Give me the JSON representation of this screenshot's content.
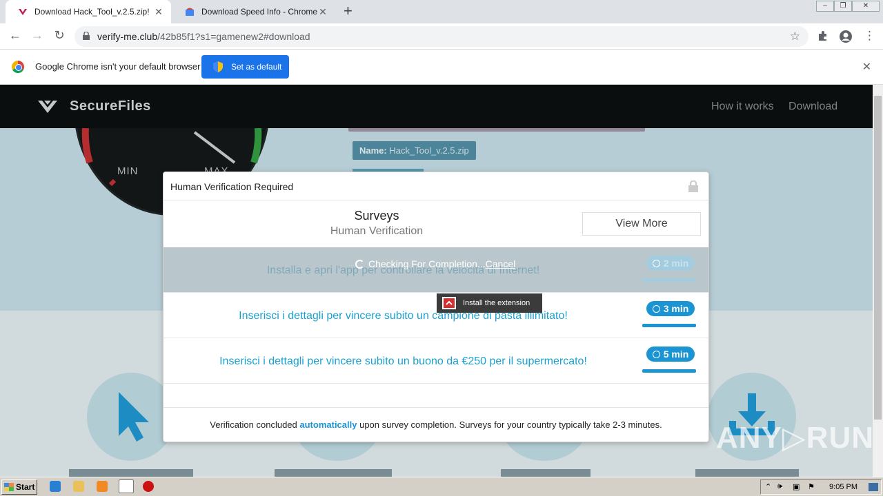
{
  "browser": {
    "tabs": [
      {
        "title": "Download Hack_Tool_v.2.5.zip!",
        "active": true
      },
      {
        "title": "Download Speed Info - Chrome Web",
        "active": false
      }
    ],
    "new_tab": "+",
    "close": "✕",
    "url_host": "verify-me.club",
    "url_path": "/42b85f1?s1=gamenew2#download",
    "infobar_text": "Google Chrome isn't your default browser",
    "set_default_label": "Set as default"
  },
  "site": {
    "brand": "SecureFiles",
    "nav": [
      "How it works",
      "Download"
    ],
    "gauge_min": "MIN",
    "gauge_max": "MAX",
    "name_label": "Name:",
    "file_name": "Hack_Tool_v.2.5.zip"
  },
  "modal": {
    "title": "Human Verification Required",
    "surveys_title": "Surveys",
    "surveys_subtitle": "Human Verification",
    "view_more": "View More",
    "checking_text": "Checking For Completion...",
    "cancel_text": "Cancel",
    "tooltip": "Install the extension",
    "offers": [
      {
        "text": "Installa e apri l'app per controllare la velocità di Internet!",
        "time": "2 min",
        "state": "checking"
      },
      {
        "text": "Inserisci i dettagli per vincere subito un campione di pasta illimitato!",
        "time": "3 min",
        "state": "normal"
      },
      {
        "text": "Inserisci i dettagli per vincere subito un buono da €250 per il supermercato!",
        "time": "5 min",
        "state": "normal"
      }
    ],
    "footer_before": "Verification concluded ",
    "footer_highlight": "automatically",
    "footer_after": " upon survey completion. Surveys for your country typically take 2-3 minutes."
  },
  "watermark": "ANY▷RUN",
  "taskbar": {
    "start_label": "Start",
    "clock": "9:05 PM"
  },
  "colors": {
    "accent": "#1a94d2",
    "chrome_blue": "#1a73e8",
    "nav_bg": "#050505"
  }
}
